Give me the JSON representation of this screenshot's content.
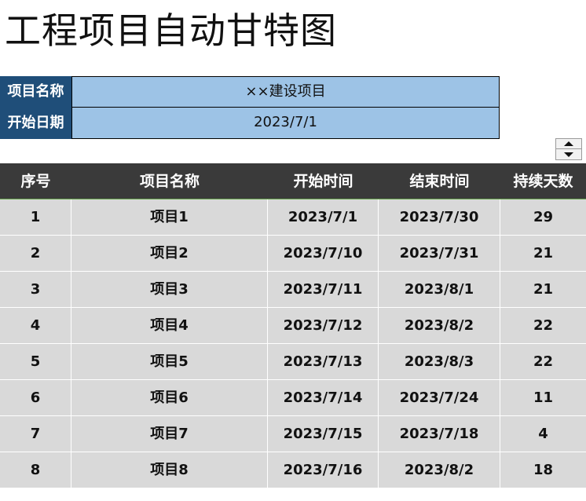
{
  "title": "工程项目自动甘特图",
  "info": {
    "project_name_label": "项目名称",
    "project_name_value": "××建设项目",
    "start_date_label": "开始日期",
    "start_date_value": "2023/7/1"
  },
  "spinner": {
    "up_icon": "triangle-up-icon",
    "down_icon": "triangle-down-icon"
  },
  "table": {
    "headers": [
      "序号",
      "项目名称",
      "开始时间",
      "结束时间",
      "持续天数"
    ],
    "rows": [
      [
        "1",
        "项目1",
        "2023/7/1",
        "2023/7/30",
        "29"
      ],
      [
        "2",
        "项目2",
        "2023/7/10",
        "2023/7/31",
        "21"
      ],
      [
        "3",
        "项目3",
        "2023/7/11",
        "2023/8/1",
        "21"
      ],
      [
        "4",
        "项目4",
        "2023/7/12",
        "2023/8/2",
        "22"
      ],
      [
        "5",
        "项目5",
        "2023/7/13",
        "2023/8/3",
        "22"
      ],
      [
        "6",
        "项目6",
        "2023/7/14",
        "2023/7/24",
        "11"
      ],
      [
        "7",
        "项目7",
        "2023/7/15",
        "2023/7/18",
        "4"
      ],
      [
        "8",
        "项目8",
        "2023/7/16",
        "2023/8/2",
        "18"
      ]
    ]
  },
  "colors": {
    "header_bg": "#3a3a3a",
    "label_bg": "#1f4e79",
    "value_bg": "#9dc3e6",
    "row_bg": "#d9d9d9"
  }
}
